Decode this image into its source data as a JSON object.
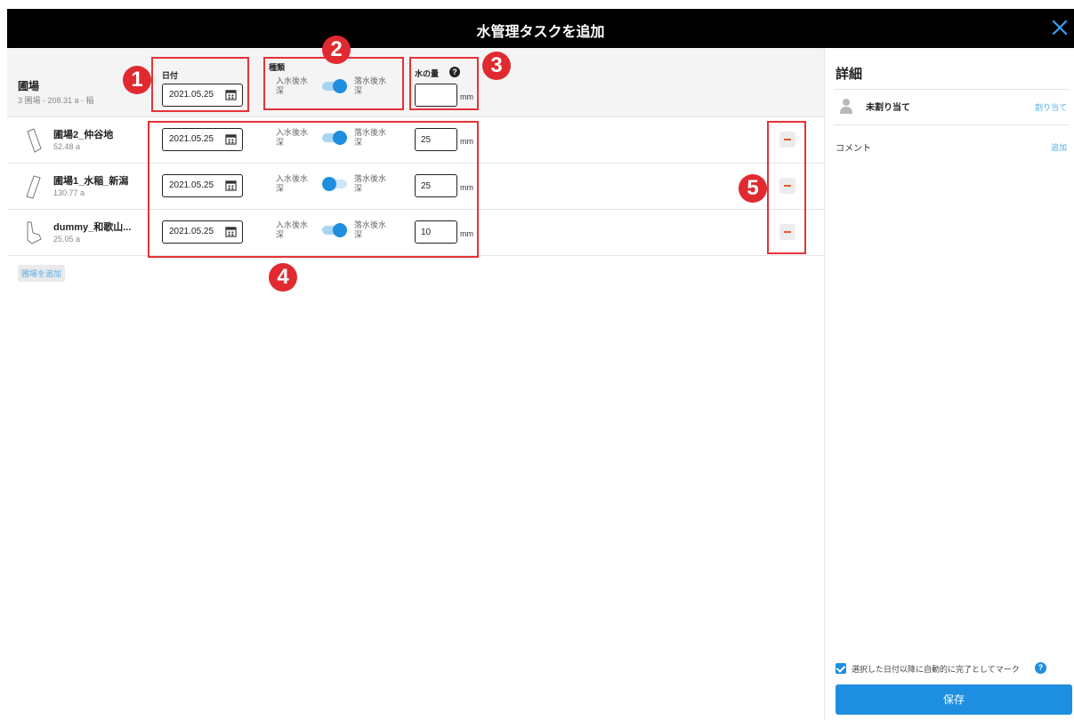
{
  "dialog": {
    "title": "水管理タスクを追加",
    "close_icon": "close-icon"
  },
  "header": {
    "field_name": "圃場",
    "field_summary": "3 圃場 - 208.31 a - 稲",
    "date_label": "日付",
    "date_value": "2021.05.25",
    "type_label": "種類",
    "type_left": "入水後水深",
    "type_right": "落水後水深",
    "water_label": "水の量",
    "water_value": "",
    "unit": "mm"
  },
  "rows": [
    {
      "name": "圃場2_仲谷地",
      "area": "52.48 a",
      "date": "2021.05.25",
      "left": "入水後水深",
      "right": "落水後水深",
      "toggle": "right",
      "water": "25",
      "unit": "mm"
    },
    {
      "name": "圃場1_水稲_新潟",
      "area": "130.77 a",
      "date": "2021.05.25",
      "left": "入水後水深",
      "right": "落水後水深",
      "toggle": "left",
      "water": "25",
      "unit": "mm"
    },
    {
      "name": "dummy_和歌山...",
      "area": "25.05 a",
      "date": "2021.05.25",
      "left": "入水後水深",
      "right": "落水後水深",
      "toggle": "right",
      "water": "10",
      "unit": "mm"
    }
  ],
  "add_field_label": "圃場を追加",
  "annotations": [
    "1",
    "2",
    "3",
    "4",
    "5"
  ],
  "sidebar": {
    "title": "詳細",
    "assign_label": "未割り当て",
    "assign_link": "割り当て",
    "comment_label": "コメント",
    "comment_link": "追加",
    "auto_complete_label": "選択した日付以降に自動的に完了としてマーク",
    "save_label": "保存"
  },
  "colors": {
    "accent": "#1e8ee0",
    "annotation": "#e02a30",
    "delete": "#e05a2a"
  }
}
